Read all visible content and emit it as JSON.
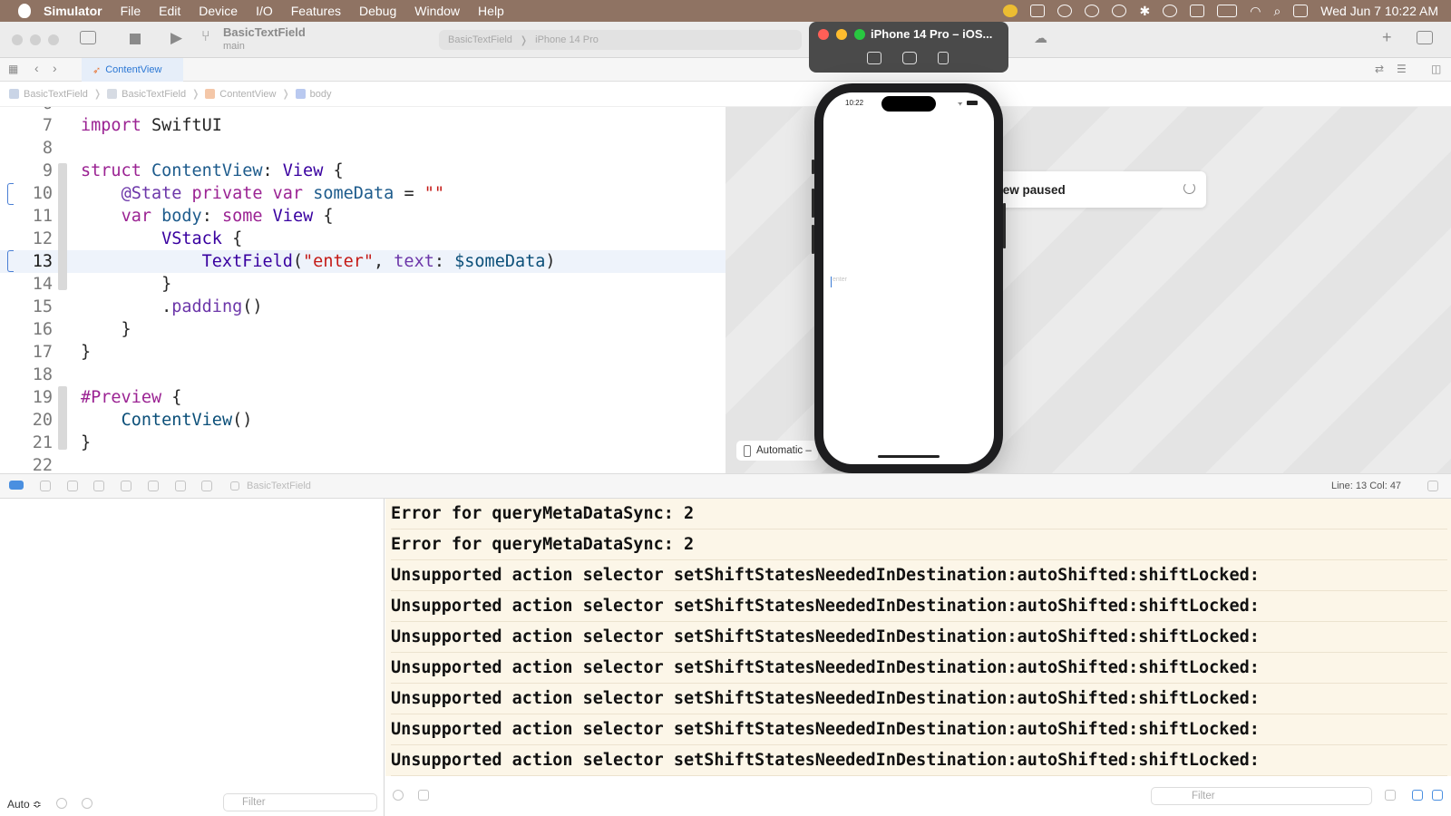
{
  "menubar": {
    "app_name": "Simulator",
    "items": [
      "File",
      "Edit",
      "Device",
      "I/O",
      "Features",
      "Debug",
      "Window",
      "Help"
    ],
    "clock": "Wed Jun 7  10:22 AM"
  },
  "toolbar": {
    "project_name": "BasicTextField",
    "branch": "main",
    "scheme": "BasicTextField",
    "destination": "iPhone 14 Pro"
  },
  "tabs": [
    {
      "label": "ContentView"
    }
  ],
  "breadcrumb": [
    "BasicTextField",
    "BasicTextField",
    "ContentView",
    "body"
  ],
  "editor": {
    "current_line": 13
  },
  "canvas": {
    "paused_text": "iew paused",
    "device_button": "Automatic –"
  },
  "simulator": {
    "title": "iPhone 14 Pro – iOS...",
    "status_time": "10:22",
    "textfield_placeholder": "enter"
  },
  "debug_bar": {
    "target": "BasicTextField",
    "position": "Line: 13  Col: 47"
  },
  "variables_pane": {
    "scope": "Auto ≎",
    "filter_placeholder": "Filter"
  },
  "console": {
    "lines": [
      "Error for queryMetaDataSync: 2",
      "Error for queryMetaDataSync: 2",
      "Unsupported action selector setShiftStatesNeededInDestination:autoShifted:shiftLocked:",
      "Unsupported action selector setShiftStatesNeededInDestination:autoShifted:shiftLocked:",
      "Unsupported action selector setShiftStatesNeededInDestination:autoShifted:shiftLocked:",
      "Unsupported action selector setShiftStatesNeededInDestination:autoShifted:shiftLocked:",
      "Unsupported action selector setShiftStatesNeededInDestination:autoShifted:shiftLocked:",
      "Unsupported action selector setShiftStatesNeededInDestination:autoShifted:shiftLocked:",
      "Unsupported action selector setShiftStatesNeededInDestination:autoShifted:shiftLocked:"
    ],
    "filter_placeholder": "Filter"
  },
  "colors": {
    "menubar": "#8f7363",
    "keyword": "#9b2393",
    "string": "#c41a16",
    "console_bg": "#fcf6e8",
    "accent": "#2b77d4"
  }
}
